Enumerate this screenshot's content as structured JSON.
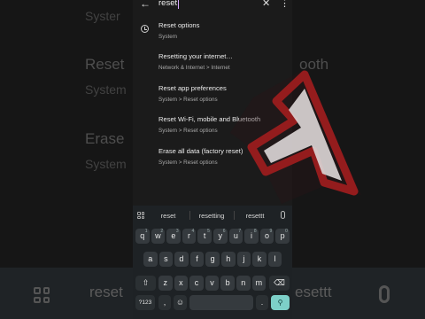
{
  "background": {
    "items": [
      {
        "title": "Reset",
        "sub": "System"
      },
      {
        "title": "Erase",
        "sub": "System"
      }
    ],
    "top_sub": "Syster",
    "peek_right": "ooth",
    "suggestions": [
      "reset",
      "esettt"
    ]
  },
  "search": {
    "query": "reset",
    "back_icon": "arrow-left-icon",
    "clear_icon": "close-icon",
    "more_icon": "more-vert-icon"
  },
  "results": [
    {
      "title": "Reset options",
      "sub": "System",
      "icon": "history-icon"
    },
    {
      "title": "Resetting your internet…",
      "sub": "Network & Internet > Internet"
    },
    {
      "title": "Reset app preferences",
      "sub": "System > Reset options"
    },
    {
      "title": "Reset Wi-Fi, mobile and Bluetooth",
      "sub": "System > Reset options"
    },
    {
      "title": "Erase all data (factory reset)",
      "sub": "System > Reset options"
    }
  ],
  "keyboard": {
    "suggestions": [
      "reset",
      "resetting",
      "resettt"
    ],
    "row1": [
      {
        "k": "q",
        "n": "1"
      },
      {
        "k": "w",
        "n": "2"
      },
      {
        "k": "e",
        "n": "3"
      },
      {
        "k": "r",
        "n": "4"
      },
      {
        "k": "t",
        "n": "5"
      },
      {
        "k": "y",
        "n": "6"
      },
      {
        "k": "u",
        "n": "7"
      },
      {
        "k": "i",
        "n": "8"
      },
      {
        "k": "o",
        "n": "9"
      },
      {
        "k": "p",
        "n": "0"
      }
    ],
    "row2": [
      "a",
      "s",
      "d",
      "f",
      "g",
      "h",
      "j",
      "k",
      "l"
    ],
    "row3": [
      "z",
      "x",
      "c",
      "v",
      "b",
      "n",
      "m"
    ],
    "shift_icon": "shift-icon",
    "backspace_icon": "backspace-icon",
    "symbols_label": "?123",
    "comma_label": ",",
    "emoji_icon": "emoji-icon",
    "period_label": ".",
    "search_icon": "search-icon",
    "action_color": "#7dd0c8"
  }
}
